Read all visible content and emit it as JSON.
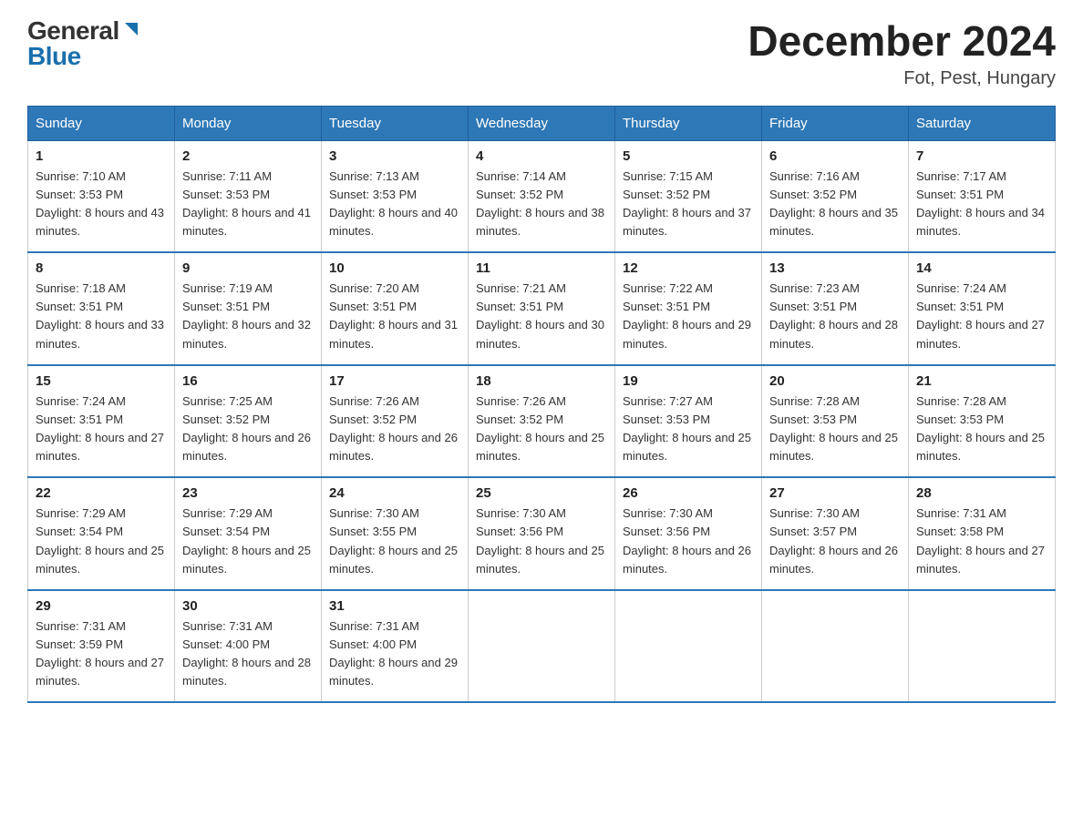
{
  "logo": {
    "general": "General",
    "blue": "Blue"
  },
  "title": "December 2024",
  "subtitle": "Fot, Pest, Hungary",
  "days_of_week": [
    "Sunday",
    "Monday",
    "Tuesday",
    "Wednesday",
    "Thursday",
    "Friday",
    "Saturday"
  ],
  "weeks": [
    [
      {
        "num": "1",
        "sunrise": "7:10 AM",
        "sunset": "3:53 PM",
        "daylight": "8 hours and 43 minutes."
      },
      {
        "num": "2",
        "sunrise": "7:11 AM",
        "sunset": "3:53 PM",
        "daylight": "8 hours and 41 minutes."
      },
      {
        "num": "3",
        "sunrise": "7:13 AM",
        "sunset": "3:53 PM",
        "daylight": "8 hours and 40 minutes."
      },
      {
        "num": "4",
        "sunrise": "7:14 AM",
        "sunset": "3:52 PM",
        "daylight": "8 hours and 38 minutes."
      },
      {
        "num": "5",
        "sunrise": "7:15 AM",
        "sunset": "3:52 PM",
        "daylight": "8 hours and 37 minutes."
      },
      {
        "num": "6",
        "sunrise": "7:16 AM",
        "sunset": "3:52 PM",
        "daylight": "8 hours and 35 minutes."
      },
      {
        "num": "7",
        "sunrise": "7:17 AM",
        "sunset": "3:51 PM",
        "daylight": "8 hours and 34 minutes."
      }
    ],
    [
      {
        "num": "8",
        "sunrise": "7:18 AM",
        "sunset": "3:51 PM",
        "daylight": "8 hours and 33 minutes."
      },
      {
        "num": "9",
        "sunrise": "7:19 AM",
        "sunset": "3:51 PM",
        "daylight": "8 hours and 32 minutes."
      },
      {
        "num": "10",
        "sunrise": "7:20 AM",
        "sunset": "3:51 PM",
        "daylight": "8 hours and 31 minutes."
      },
      {
        "num": "11",
        "sunrise": "7:21 AM",
        "sunset": "3:51 PM",
        "daylight": "8 hours and 30 minutes."
      },
      {
        "num": "12",
        "sunrise": "7:22 AM",
        "sunset": "3:51 PM",
        "daylight": "8 hours and 29 minutes."
      },
      {
        "num": "13",
        "sunrise": "7:23 AM",
        "sunset": "3:51 PM",
        "daylight": "8 hours and 28 minutes."
      },
      {
        "num": "14",
        "sunrise": "7:24 AM",
        "sunset": "3:51 PM",
        "daylight": "8 hours and 27 minutes."
      }
    ],
    [
      {
        "num": "15",
        "sunrise": "7:24 AM",
        "sunset": "3:51 PM",
        "daylight": "8 hours and 27 minutes."
      },
      {
        "num": "16",
        "sunrise": "7:25 AM",
        "sunset": "3:52 PM",
        "daylight": "8 hours and 26 minutes."
      },
      {
        "num": "17",
        "sunrise": "7:26 AM",
        "sunset": "3:52 PM",
        "daylight": "8 hours and 26 minutes."
      },
      {
        "num": "18",
        "sunrise": "7:26 AM",
        "sunset": "3:52 PM",
        "daylight": "8 hours and 25 minutes."
      },
      {
        "num": "19",
        "sunrise": "7:27 AM",
        "sunset": "3:53 PM",
        "daylight": "8 hours and 25 minutes."
      },
      {
        "num": "20",
        "sunrise": "7:28 AM",
        "sunset": "3:53 PM",
        "daylight": "8 hours and 25 minutes."
      },
      {
        "num": "21",
        "sunrise": "7:28 AM",
        "sunset": "3:53 PM",
        "daylight": "8 hours and 25 minutes."
      }
    ],
    [
      {
        "num": "22",
        "sunrise": "7:29 AM",
        "sunset": "3:54 PM",
        "daylight": "8 hours and 25 minutes."
      },
      {
        "num": "23",
        "sunrise": "7:29 AM",
        "sunset": "3:54 PM",
        "daylight": "8 hours and 25 minutes."
      },
      {
        "num": "24",
        "sunrise": "7:30 AM",
        "sunset": "3:55 PM",
        "daylight": "8 hours and 25 minutes."
      },
      {
        "num": "25",
        "sunrise": "7:30 AM",
        "sunset": "3:56 PM",
        "daylight": "8 hours and 25 minutes."
      },
      {
        "num": "26",
        "sunrise": "7:30 AM",
        "sunset": "3:56 PM",
        "daylight": "8 hours and 26 minutes."
      },
      {
        "num": "27",
        "sunrise": "7:30 AM",
        "sunset": "3:57 PM",
        "daylight": "8 hours and 26 minutes."
      },
      {
        "num": "28",
        "sunrise": "7:31 AM",
        "sunset": "3:58 PM",
        "daylight": "8 hours and 27 minutes."
      }
    ],
    [
      {
        "num": "29",
        "sunrise": "7:31 AM",
        "sunset": "3:59 PM",
        "daylight": "8 hours and 27 minutes."
      },
      {
        "num": "30",
        "sunrise": "7:31 AM",
        "sunset": "4:00 PM",
        "daylight": "8 hours and 28 minutes."
      },
      {
        "num": "31",
        "sunrise": "7:31 AM",
        "sunset": "4:00 PM",
        "daylight": "8 hours and 29 minutes."
      },
      null,
      null,
      null,
      null
    ]
  ]
}
